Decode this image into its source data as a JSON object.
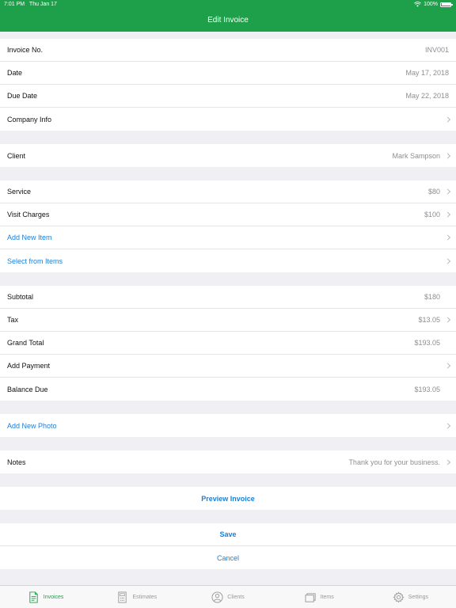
{
  "status": {
    "time": "7:01 PM",
    "date": "Thu Jan 17",
    "battery": "100%"
  },
  "header": {
    "title": "Edit Invoice"
  },
  "invoice": {
    "number_label": "Invoice No.",
    "number_value": "INV001",
    "date_label": "Date",
    "date_value": "May 17, 2018",
    "due_label": "Due Date",
    "due_value": "May 22, 2018",
    "company_label": "Company Info"
  },
  "client": {
    "label": "Client",
    "value": "Mark Sampson"
  },
  "items": [
    {
      "label": "Service",
      "value": "$80"
    },
    {
      "label": "Visit Charges",
      "value": "$100"
    }
  ],
  "item_actions": {
    "add": "Add New Item",
    "select": "Select from Items"
  },
  "totals": {
    "subtotal_label": "Subtotal",
    "subtotal_value": "$180",
    "tax_label": "Tax",
    "tax_value": "$13.05",
    "grand_label": "Grand Total",
    "grand_value": "$193.05",
    "payment_label": "Add Payment",
    "balance_label": "Balance Due",
    "balance_value": "$193.05"
  },
  "photo": {
    "label": "Add New Photo"
  },
  "notes": {
    "label": "Notes",
    "value": "Thank you for your business."
  },
  "actions": {
    "preview": "Preview Invoice",
    "save": "Save",
    "cancel": "Cancel"
  },
  "tabs": [
    {
      "label": "Invoices",
      "icon": "invoice-icon"
    },
    {
      "label": "Estimates",
      "icon": "calculator-icon"
    },
    {
      "label": "Clients",
      "icon": "person-icon"
    },
    {
      "label": "Items",
      "icon": "stack-icon"
    },
    {
      "label": "Settings",
      "icon": "gear-icon"
    }
  ],
  "colors": {
    "accent": "#1ea04a",
    "link": "#1b7fd6"
  }
}
